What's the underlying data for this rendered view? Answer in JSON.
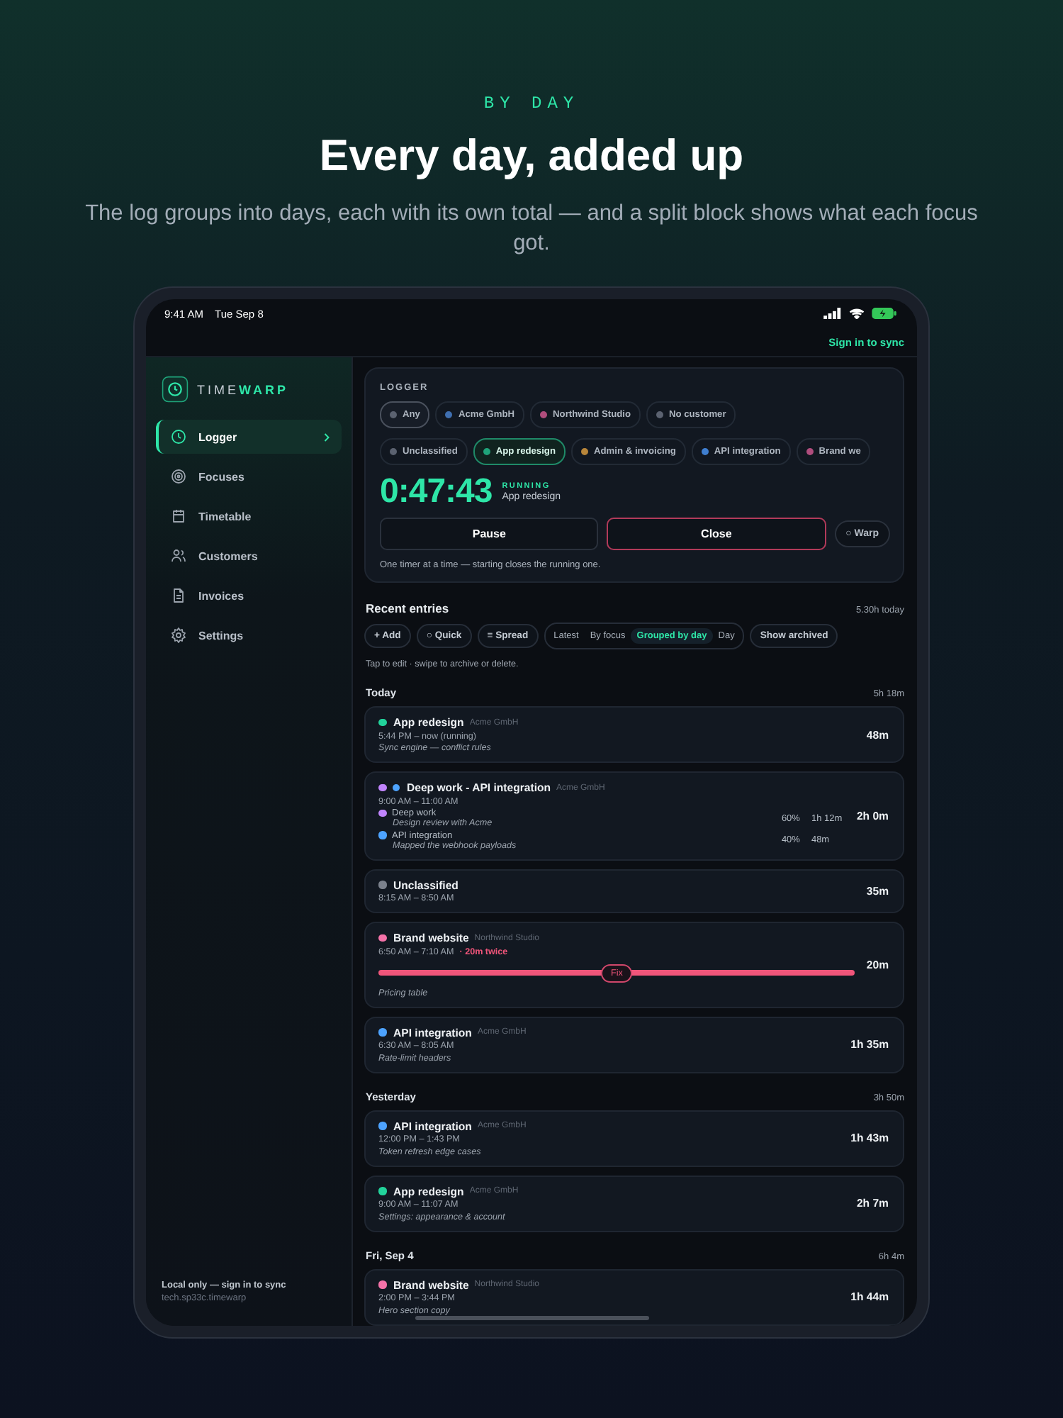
{
  "hero": {
    "eyebrow": "BY DAY",
    "title": "Every day, added up",
    "subtitle": "The log groups into days, each with its own total — and a split block shows what each focus got."
  },
  "status_bar": {
    "time": "9:41 AM",
    "date": "Tue Sep 8"
  },
  "sync_link": "Sign in to sync",
  "sidebar": {
    "brand_light": "TIME",
    "brand_bold": "WARP",
    "items": [
      {
        "label": "Logger",
        "selected": true
      },
      {
        "label": "Focuses",
        "selected": false
      },
      {
        "label": "Timetable",
        "selected": false
      },
      {
        "label": "Customers",
        "selected": false
      },
      {
        "label": "Invoices",
        "selected": false
      },
      {
        "label": "Settings",
        "selected": false
      }
    ],
    "footer": "Local only — sign in to sync",
    "bundle_id": "tech.sp33c.timewarp"
  },
  "logger": {
    "heading": "LOGGER",
    "customer_chips": [
      {
        "label": "Any",
        "color": "#5b6270",
        "selected": true
      },
      {
        "label": "Acme GmbH",
        "color": "#3f6fb0",
        "selected": false
      },
      {
        "label": "Northwind Studio",
        "color": "#b04d7d",
        "selected": false
      },
      {
        "label": "No customer",
        "color": "#5b6270",
        "selected": false
      }
    ],
    "focus_chips": [
      {
        "label": "Unclassified",
        "color": "#5b6270",
        "selected": false
      },
      {
        "label": "App redesign",
        "color": "#1fa37a",
        "selected": true
      },
      {
        "label": "Admin & invoicing",
        "color": "#b8863a",
        "selected": false
      },
      {
        "label": "API integration",
        "color": "#3f7fd0",
        "selected": false
      },
      {
        "label": "Brand we",
        "color": "#b04d7d",
        "selected": false
      }
    ],
    "timer": "0:47:43",
    "status": "RUNNING",
    "running_focus": "App redesign",
    "buttons": [
      {
        "label": "Pause",
        "kind": "plain"
      },
      {
        "label": "Close",
        "kind": "danger"
      },
      {
        "label": "○ Warp",
        "kind": "small"
      }
    ],
    "hint": "One timer at a time — starting closes the running one."
  },
  "recent": {
    "heading": "Recent entries",
    "total": "5.30h today",
    "actions": [
      "+ Add",
      "○ Quick",
      "≡ Spread"
    ],
    "views": [
      {
        "label": "Latest",
        "selected": false
      },
      {
        "label": "By focus",
        "selected": false
      },
      {
        "label": "Grouped by day",
        "selected": true
      },
      {
        "label": "Day",
        "selected": false
      }
    ],
    "archived_button": "Show archived",
    "hint": "Tap to edit · swipe to archive or delete."
  },
  "days": [
    {
      "label": "Today",
      "total": "5h 18m",
      "entries": [
        {
          "kind": "simple",
          "title": "App redesign",
          "color": "#22d39b",
          "customer": "Acme GmbH",
          "time": "5:44 PM – now  (running)",
          "note": "Sync engine — conflict rules",
          "duration": "48m"
        },
        {
          "kind": "split",
          "title": "Deep work - API integration",
          "customer": "Acme GmbH",
          "time": "9:00 AM – 11:00 AM",
          "duration": "2h 0m",
          "parts": [
            {
              "label": "Deep work",
              "color": "#c084fc",
              "note": "Design review with Acme",
              "share": "60%",
              "amount": "1h 12m"
            },
            {
              "label": "API integration",
              "color": "#4da3ff",
              "note": "Mapped the webhook payloads",
              "share": "40%",
              "amount": "48m"
            }
          ]
        },
        {
          "kind": "simple",
          "title": "Unclassified",
          "color": "#7b818c",
          "time": "8:15 AM – 8:50 AM",
          "duration": "35m"
        },
        {
          "kind": "conflict",
          "title": "Brand website",
          "color": "#f472a8",
          "customer": "Northwind Studio",
          "time": "6:50 AM – 7:10 AM",
          "warning": "· 20m twice",
          "fix": "Fix",
          "note": "Pricing table",
          "duration": "20m"
        },
        {
          "kind": "simple",
          "title": "API integration",
          "color": "#4da3ff",
          "customer": "Acme GmbH",
          "time": "6:30 AM – 8:05 AM",
          "note": "Rate-limit headers",
          "duration": "1h 35m"
        }
      ]
    },
    {
      "label": "Yesterday",
      "total": "3h 50m",
      "entries": [
        {
          "kind": "simple",
          "title": "API integration",
          "color": "#4da3ff",
          "customer": "Acme GmbH",
          "time": "12:00 PM – 1:43 PM",
          "note": "Token refresh edge cases",
          "duration": "1h 43m"
        },
        {
          "kind": "simple",
          "title": "App redesign",
          "color": "#22d39b",
          "customer": "Acme GmbH",
          "time": "9:00 AM – 11:07 AM",
          "note": "Settings: appearance & account",
          "duration": "2h 7m"
        }
      ]
    },
    {
      "label": "Fri, Sep 4",
      "total": "6h 4m",
      "entries": [
        {
          "kind": "simple",
          "title": "Brand website",
          "color": "#f472a8",
          "customer": "Northwind Studio",
          "time": "2:00 PM – 3:44 PM",
          "note": "Hero section copy",
          "duration": "1h 44m"
        }
      ]
    }
  ]
}
